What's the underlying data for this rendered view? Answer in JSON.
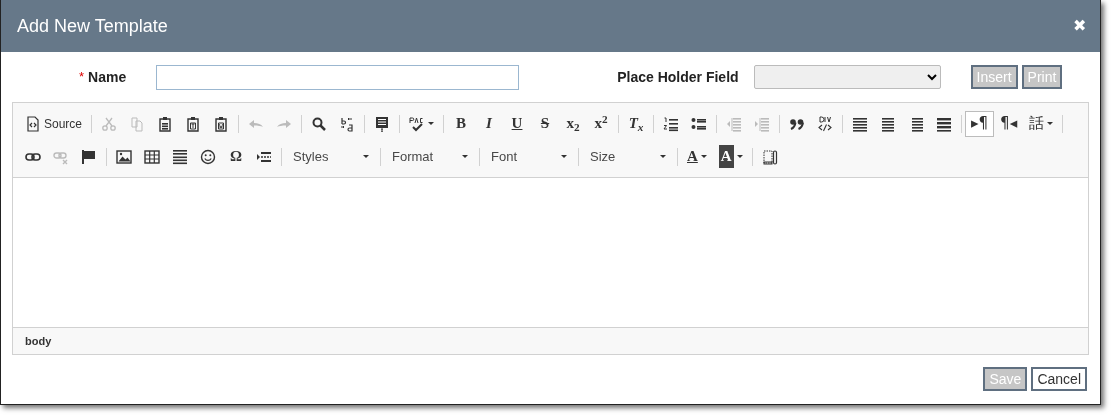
{
  "dialog": {
    "title": "Add New Template",
    "close": "✖"
  },
  "form": {
    "name_label": "Name",
    "required_mark": "*",
    "placeholder_label": "Place Holder Field",
    "buttons": [
      {
        "label": "Insert",
        "disabled": true
      },
      {
        "label": "Print",
        "disabled": true
      }
    ]
  },
  "editor": {
    "toolbar_rows": [
      [
        {
          "kind": "label",
          "text": "Source",
          "disabled": false,
          "on": false
        },
        {
          "kind": "sep"
        },
        {
          "kind": "icon",
          "disabled": true,
          "on": false
        },
        {
          "kind": "icon",
          "disabled": true,
          "on": false
        },
        {
          "kind": "icon",
          "disabled": false,
          "on": false
        },
        {
          "kind": "icon",
          "disabled": false,
          "on": false
        },
        {
          "kind": "icon",
          "disabled": false,
          "on": false
        },
        {
          "kind": "sep"
        },
        {
          "kind": "icon",
          "disabled": true,
          "on": false
        },
        {
          "kind": "icon",
          "disabled": true,
          "on": false
        },
        {
          "kind": "sep"
        },
        {
          "kind": "icon",
          "disabled": false,
          "on": false
        },
        {
          "kind": "icon",
          "disabled": false,
          "on": false
        },
        {
          "kind": "sep"
        },
        {
          "kind": "icon",
          "disabled": false,
          "on": false
        },
        {
          "kind": "sep"
        },
        {
          "kind": "icon",
          "disabled": false,
          "on": false
        },
        {
          "kind": "sep"
        },
        {
          "kind": "glyph",
          "text": "B",
          "disabled": false,
          "on": false
        },
        {
          "kind": "glyph",
          "text": "I",
          "disabled": false,
          "on": false
        },
        {
          "kind": "glyph",
          "text": "U",
          "disabled": false,
          "on": false
        },
        {
          "kind": "glyph",
          "text": "S",
          "disabled": false,
          "on": false
        },
        {
          "kind": "glyph",
          "text": "x$_{2}$",
          "disabled": false,
          "on": false
        },
        {
          "kind": "glyph",
          "text": "x$^{2}$",
          "disabled": false,
          "on": false
        },
        {
          "kind": "sep"
        },
        {
          "kind": "glyph",
          "text": "T$_{x}$",
          "disabled": false,
          "on": false
        },
        {
          "kind": "sep"
        },
        {
          "kind": "icon",
          "disabled": false,
          "on": false
        },
        {
          "kind": "icon",
          "disabled": false,
          "on": false
        },
        {
          "kind": "sep"
        },
        {
          "kind": "icon",
          "disabled": true,
          "on": false
        },
        {
          "kind": "icon",
          "disabled": true,
          "on": false
        },
        {
          "kind": "sep"
        },
        {
          "kind": "icon",
          "disabled": false,
          "on": false
        },
        {
          "kind": "icon",
          "disabled": false,
          "on": false
        },
        {
          "kind": "sep"
        },
        {
          "kind": "icon",
          "disabled": false,
          "on": false
        },
        {
          "kind": "icon",
          "disabled": false,
          "on": false
        },
        {
          "kind": "icon",
          "disabled": false,
          "on": false
        },
        {
          "kind": "icon",
          "disabled": false,
          "on": false
        },
        {
          "kind": "sep"
        },
        {
          "kind": "glyph",
          "text": "▸¶",
          "disabled": false,
          "on": true
        },
        {
          "kind": "glyph",
          "text": "¶◂",
          "disabled": false,
          "on": false
        },
        {
          "kind": "glyph",
          "text": "話",
          "disabled": false,
          "on": false,
          "caret": true
        },
        {
          "kind": "sep"
        }
      ],
      [
        {
          "kind": "icon",
          "disabled": false,
          "on": false
        },
        {
          "kind": "icon",
          "disabled": true,
          "on": false
        },
        {
          "kind": "icon",
          "disabled": false,
          "on": false
        },
        {
          "kind": "sep"
        },
        {
          "kind": "icon",
          "disabled": false,
          "on": false
        },
        {
          "kind": "icon",
          "disabled": false,
          "on": false
        },
        {
          "kind": "icon",
          "disabled": false,
          "on": false
        },
        {
          "kind": "icon",
          "disabled": false,
          "on": false
        },
        {
          "kind": "glyph",
          "text": "Ω",
          "disabled": false,
          "on": false
        },
        {
          "kind": "icon",
          "disabled": false,
          "on": false
        },
        {
          "kind": "sep"
        },
        {
          "kind": "combo",
          "text": "Styles"
        },
        {
          "kind": "sep"
        },
        {
          "kind": "combo",
          "text": "Format"
        },
        {
          "kind": "sep"
        },
        {
          "kind": "combo",
          "text": "Font"
        },
        {
          "kind": "sep"
        },
        {
          "kind": "combo",
          "text": "Size"
        },
        {
          "kind": "sep"
        },
        {
          "kind": "glyph",
          "text": "A",
          "disabled": false,
          "on": false,
          "caret": true
        },
        {
          "kind": "glyph",
          "text": "A",
          "disabled": false,
          "on": false,
          "caret": true
        },
        {
          "kind": "sep"
        },
        {
          "kind": "icon",
          "disabled": false,
          "on": false
        }
      ]
    ],
    "path": "body"
  },
  "footer": {
    "buttons": [
      {
        "label": "Save",
        "disabled": true
      },
      {
        "label": "Cancel",
        "disabled": false
      }
    ]
  }
}
